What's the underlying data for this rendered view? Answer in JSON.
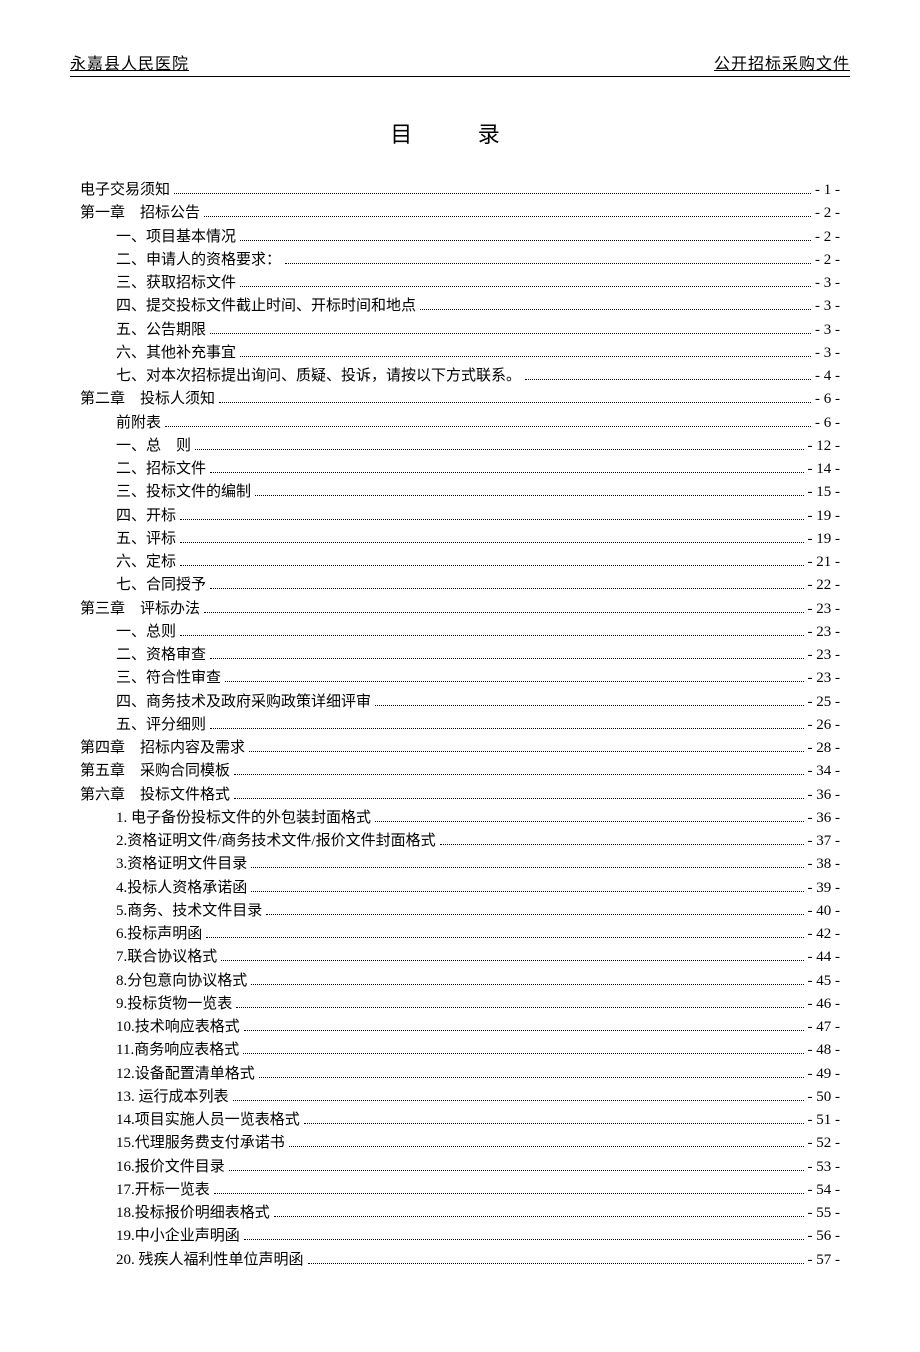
{
  "header": {
    "left": "永嘉县人民医院",
    "right": "公开招标采购文件"
  },
  "title": "目  录",
  "toc": [
    {
      "level": 0,
      "text": "电子交易须知",
      "page": "- 1 -"
    },
    {
      "level": 0,
      "text": "第一章　招标公告",
      "page": "- 2 -"
    },
    {
      "level": 1,
      "text": "一、项目基本情况",
      "page": "- 2 -"
    },
    {
      "level": 1,
      "text": "二、申请人的资格要求：",
      "page": "- 2 -"
    },
    {
      "level": 1,
      "text": "三、获取招标文件",
      "page": "- 3 -"
    },
    {
      "level": 1,
      "text": "四、提交投标文件截止时间、开标时间和地点",
      "page": "- 3 -"
    },
    {
      "level": 1,
      "text": "五、公告期限",
      "page": "- 3 -"
    },
    {
      "level": 1,
      "text": "六、其他补充事宜",
      "page": "- 3 -"
    },
    {
      "level": 1,
      "text": "七、对本次招标提出询问、质疑、投诉，请按以下方式联系。",
      "page": "- 4 -"
    },
    {
      "level": 0,
      "text": "第二章　投标人须知",
      "page": "- 6 -"
    },
    {
      "level": 1,
      "text": "前附表",
      "page": "- 6 -"
    },
    {
      "level": 1,
      "text": "一、总　则",
      "page": "- 12 -"
    },
    {
      "level": 1,
      "text": "二、招标文件",
      "page": "- 14 -"
    },
    {
      "level": 1,
      "text": "三、投标文件的编制",
      "page": "- 15 -"
    },
    {
      "level": 1,
      "text": "四、开标",
      "page": "- 19 -"
    },
    {
      "level": 1,
      "text": "五、评标",
      "page": "- 19 -"
    },
    {
      "level": 1,
      "text": "六、定标",
      "page": "- 21 -"
    },
    {
      "level": 1,
      "text": "七、合同授予",
      "page": "- 22 -"
    },
    {
      "level": 0,
      "text": "第三章　评标办法",
      "page": "- 23 -"
    },
    {
      "level": 1,
      "text": "一、总则",
      "page": "- 23 -"
    },
    {
      "level": 1,
      "text": "二、资格审查",
      "page": "- 23 -"
    },
    {
      "level": 1,
      "text": "三、符合性审查",
      "page": "- 23 -"
    },
    {
      "level": 1,
      "text": "四、商务技术及政府采购政策详细评审",
      "page": "- 25 -"
    },
    {
      "level": 1,
      "text": "五、评分细则",
      "page": "- 26 -"
    },
    {
      "level": 0,
      "text": "第四章　招标内容及需求",
      "page": "- 28 -"
    },
    {
      "level": 0,
      "text": "第五章　采购合同模板",
      "page": "- 34 -"
    },
    {
      "level": 0,
      "text": "第六章　投标文件格式",
      "page": "- 36 -"
    },
    {
      "level": 1,
      "text": "1. 电子备份投标文件的外包装封面格式",
      "page": "- 36 -"
    },
    {
      "level": 1,
      "text": "2.资格证明文件/商务技术文件/报价文件封面格式",
      "page": "- 37 -"
    },
    {
      "level": 1,
      "text": "3.资格证明文件目录",
      "page": "- 38 -"
    },
    {
      "level": 1,
      "text": "4.投标人资格承诺函",
      "page": "- 39 -"
    },
    {
      "level": 1,
      "text": "5.商务、技术文件目录",
      "page": "- 40 -"
    },
    {
      "level": 1,
      "text": "6.投标声明函",
      "page": "- 42 -"
    },
    {
      "level": 1,
      "text": "7.联合协议格式",
      "page": "- 44 -"
    },
    {
      "level": 1,
      "text": "8.分包意向协议格式",
      "page": "- 45 -"
    },
    {
      "level": 1,
      "text": "9.投标货物一览表",
      "page": "- 46 -"
    },
    {
      "level": 1,
      "text": "10.技术响应表格式",
      "page": "- 47 -"
    },
    {
      "level": 1,
      "text": "11.商务响应表格式",
      "page": "- 48 -"
    },
    {
      "level": 1,
      "text": "12.设备配置清单格式",
      "page": "- 49 -"
    },
    {
      "level": 1,
      "text": "13. 运行成本列表",
      "page": "- 50 -"
    },
    {
      "level": 1,
      "text": "14.项目实施人员一览表格式",
      "page": "- 51 -"
    },
    {
      "level": 1,
      "text": "15.代理服务费支付承诺书",
      "page": "- 52 -"
    },
    {
      "level": 1,
      "text": "16.报价文件目录",
      "page": "- 53 -"
    },
    {
      "level": 1,
      "text": "17.开标一览表",
      "page": "- 54 -"
    },
    {
      "level": 1,
      "text": "18.投标报价明细表格式",
      "page": "- 55 -"
    },
    {
      "level": 1,
      "text": "19.中小企业声明函",
      "page": "- 56 -"
    },
    {
      "level": 1,
      "text": "20. 残疾人福利性单位声明函",
      "page": "- 57 -"
    }
  ]
}
